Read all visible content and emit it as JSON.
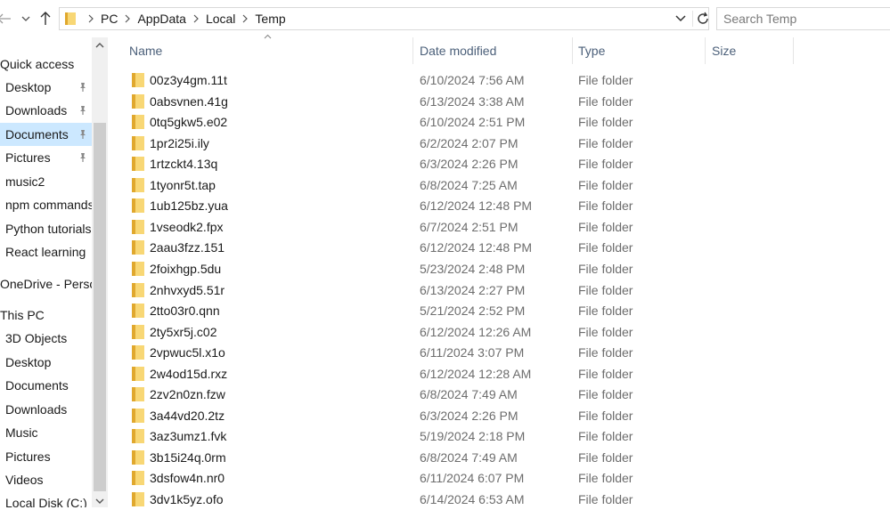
{
  "toolbar": {
    "back_icon": "back-arrow-icon",
    "recent_icon": "chevron-down-icon",
    "up_icon": "up-arrow-icon"
  },
  "address_bar": {
    "breadcrumbs": [
      "PC",
      "AppData",
      "Local",
      "Temp"
    ],
    "dropdown_icon": "chevron-down-icon",
    "refresh_icon": "refresh-icon"
  },
  "search": {
    "placeholder": "Search Temp"
  },
  "sidebar": {
    "items": [
      {
        "label": "Quick access",
        "type": "section"
      },
      {
        "label": "Desktop",
        "pinned": true
      },
      {
        "label": "Downloads",
        "pinned": true
      },
      {
        "label": "Documents",
        "pinned": true,
        "selected": true
      },
      {
        "label": "Pictures",
        "pinned": true
      },
      {
        "label": "music2"
      },
      {
        "label": "npm commands"
      },
      {
        "label": "Python tutorials"
      },
      {
        "label": "React learning"
      },
      {
        "label": "OneDrive - Person",
        "type": "section"
      },
      {
        "label": "This PC",
        "type": "section"
      },
      {
        "label": "3D Objects"
      },
      {
        "label": "Desktop"
      },
      {
        "label": "Documents"
      },
      {
        "label": "Downloads"
      },
      {
        "label": "Music"
      },
      {
        "label": "Pictures"
      },
      {
        "label": "Videos"
      },
      {
        "label": "Local Disk (C:)"
      }
    ]
  },
  "columns": {
    "name": "Name",
    "date": "Date modified",
    "type": "Type",
    "size": "Size"
  },
  "files": [
    {
      "name": "00z3y4gm.11t",
      "date": "6/10/2024 7:56 AM",
      "type": "File folder"
    },
    {
      "name": "0absvnen.41g",
      "date": "6/13/2024 3:38 AM",
      "type": "File folder"
    },
    {
      "name": "0tq5gkw5.e02",
      "date": "6/10/2024 2:51 PM",
      "type": "File folder"
    },
    {
      "name": "1pr2i25i.ily",
      "date": "6/2/2024 2:07 PM",
      "type": "File folder"
    },
    {
      "name": "1rtzckt4.13q",
      "date": "6/3/2024 2:26 PM",
      "type": "File folder"
    },
    {
      "name": "1tyonr5t.tap",
      "date": "6/8/2024 7:25 AM",
      "type": "File folder"
    },
    {
      "name": "1ub125bz.yua",
      "date": "6/12/2024 12:48 PM",
      "type": "File folder"
    },
    {
      "name": "1vseodk2.fpx",
      "date": "6/7/2024 2:51 PM",
      "type": "File folder"
    },
    {
      "name": "2aau3fzz.151",
      "date": "6/12/2024 12:48 PM",
      "type": "File folder"
    },
    {
      "name": "2foixhgp.5du",
      "date": "5/23/2024 2:48 PM",
      "type": "File folder"
    },
    {
      "name": "2nhvxyd5.51r",
      "date": "6/13/2024 2:27 PM",
      "type": "File folder"
    },
    {
      "name": "2tto03r0.qnn",
      "date": "5/21/2024 2:52 PM",
      "type": "File folder"
    },
    {
      "name": "2ty5xr5j.c02",
      "date": "6/12/2024 12:26 AM",
      "type": "File folder"
    },
    {
      "name": "2vpwuc5l.x1o",
      "date": "6/11/2024 3:07 PM",
      "type": "File folder"
    },
    {
      "name": "2w4od15d.rxz",
      "date": "6/12/2024 12:28 AM",
      "type": "File folder"
    },
    {
      "name": "2zv2n0zn.fzw",
      "date": "6/8/2024 7:49 AM",
      "type": "File folder"
    },
    {
      "name": "3a44vd20.2tz",
      "date": "6/3/2024 2:26 PM",
      "type": "File folder"
    },
    {
      "name": "3az3umz1.fvk",
      "date": "5/19/2024 2:18 PM",
      "type": "File folder"
    },
    {
      "name": "3b15i24q.0rm",
      "date": "6/8/2024 7:49 AM",
      "type": "File folder"
    },
    {
      "name": "3dsfow4n.nr0",
      "date": "6/11/2024 6:07 PM",
      "type": "File folder"
    },
    {
      "name": "3dv1k5yz.ofo",
      "date": "6/14/2024 6:53 AM",
      "type": "File folder"
    }
  ],
  "colors": {
    "selected_bg": "#cce8ff",
    "folder_yellow": "#f8d775",
    "folder_dark": "#e0a82e",
    "header_text": "#4c607a"
  }
}
